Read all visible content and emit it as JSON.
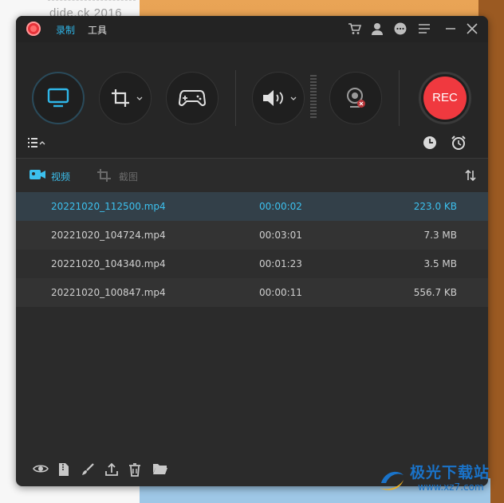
{
  "background": {
    "left_text": "dide.ck 2016"
  },
  "titlebar": {
    "menu_record": "录制",
    "menu_tools": "工具",
    "icons": [
      "cart-icon",
      "user-icon",
      "chat-icon",
      "menu-icon",
      "minimize-icon",
      "close-icon"
    ]
  },
  "controls": {
    "rec_label": "REC",
    "accent": "#2fb6e8",
    "rec_color": "#f0393f"
  },
  "tabs": {
    "video": "视频",
    "screenshot": "截图"
  },
  "files": [
    {
      "name": "20221020_112500.mp4",
      "duration": "00:00:02",
      "size": "223.0 KB"
    },
    {
      "name": "20221020_104724.mp4",
      "duration": "00:03:01",
      "size": "7.3 MB"
    },
    {
      "name": "20221020_104340.mp4",
      "duration": "00:01:23",
      "size": "3.5 MB"
    },
    {
      "name": "20221020_100847.mp4",
      "duration": "00:00:11",
      "size": "556.7 KB"
    }
  ],
  "watermark": {
    "text": "极光下载站",
    "url": "www.xz7.com"
  }
}
